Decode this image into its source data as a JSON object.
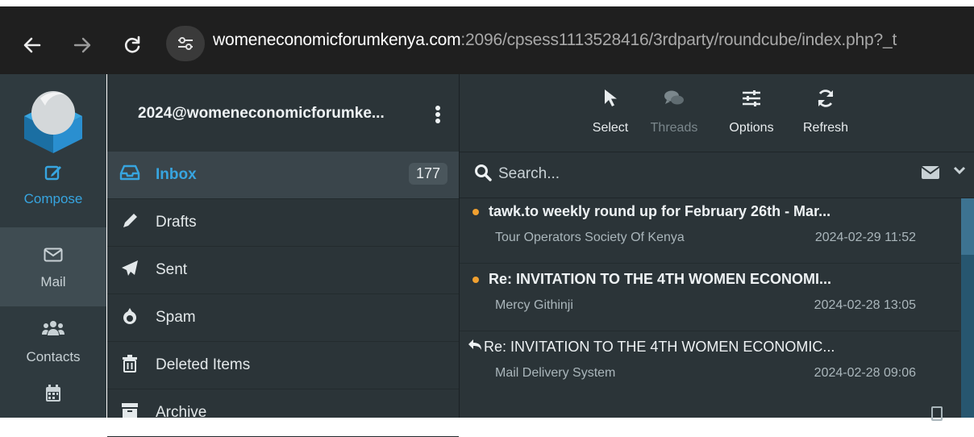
{
  "browser": {
    "back_icon": "back-arrow-icon",
    "forward_icon": "forward-arrow-icon",
    "reload_icon": "reload-icon",
    "site_info_icon": "tune-icon",
    "url_host": "womeneconomicforumkenya.com",
    "url_path": ":2096/cpsess1113528416/3rdparty/roundcube/index.php?_t"
  },
  "rail": {
    "compose_label": "Compose",
    "mail_label": "Mail",
    "contacts_label": "Contacts"
  },
  "account": {
    "name": "2024@womeneconomicforumke..."
  },
  "folders": [
    {
      "label": "Inbox",
      "count": "177",
      "icon": "inbox-icon"
    },
    {
      "label": "Drafts",
      "icon": "pencil-icon"
    },
    {
      "label": "Sent",
      "icon": "paper-plane-icon"
    },
    {
      "label": "Spam",
      "icon": "fire-icon"
    },
    {
      "label": "Deleted Items",
      "icon": "trash-icon"
    },
    {
      "label": "Archive",
      "icon": "archive-icon"
    }
  ],
  "toolbar": {
    "select_label": "Select",
    "threads_label": "Threads",
    "options_label": "Options",
    "refresh_label": "Refresh"
  },
  "search": {
    "placeholder": "Search..."
  },
  "messages": [
    {
      "subject": "tawk.to weekly round up for February 26th - Mar...",
      "from": "Tour Operators Society Of Kenya",
      "date": "2024-02-29 11:52",
      "unread": true
    },
    {
      "subject": "Re: INVITATION TO THE 4TH WOMEN ECONOMI...",
      "from": "Mercy Githinji",
      "date": "2024-02-28 13:05",
      "unread": true
    },
    {
      "subject": "Re: INVITATION TO THE 4TH WOMEN ECONOMIC...",
      "from": "Mail Delivery System",
      "date": "2024-02-28 09:06",
      "unread": false,
      "replied": true
    }
  ],
  "colors": {
    "accent": "#37a5e0",
    "unread_dot": "#f0a030",
    "panel_bg": "#2b3438",
    "rail_bg": "#2f3a3f"
  }
}
